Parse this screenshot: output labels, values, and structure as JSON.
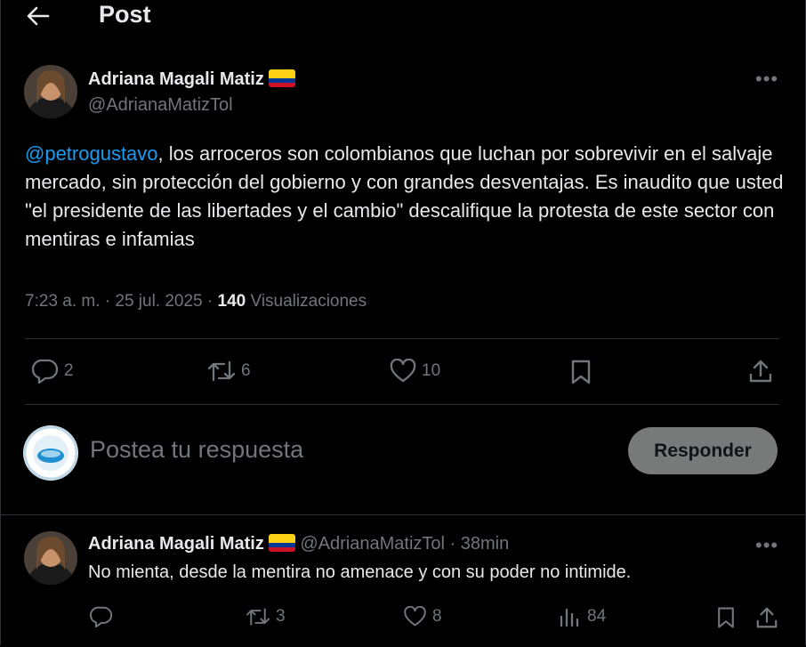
{
  "header": {
    "title": "Post",
    "back_icon": "arrow-left-icon"
  },
  "post": {
    "author_name": "Adriana Magali Matiz",
    "author_handle": "@AdrianaMatizTol",
    "flag": "colombia-flag",
    "mention": "@petrogustavo",
    "text": ", los arroceros son colombianos que luchan por sobrevivir en el salvaje mercado, sin protección del gobierno y con grandes desventajas. Es inaudito que usted \"el presidente de las libertades y el cambio\" descalifique la protesta de este sector con mentiras e infamias",
    "time": "7:23 a. m. · 25 jul. 2025 · ",
    "views_count": "140",
    "views_label": " Visualizaciones",
    "replies": "2",
    "reposts": "6",
    "likes": "10"
  },
  "composer": {
    "placeholder": "Postea tu respuesta",
    "button_label": "Responder"
  },
  "reply": {
    "author_name": "Adriana Magali Matiz",
    "author_handle": "@AdrianaMatizTol",
    "time": " · 38min",
    "text": "No mienta, desde la mentira no amenace y con su poder no intimide.",
    "reposts": "3",
    "likes": "8",
    "views": "84"
  },
  "colors": {
    "accent": "#1d9bf0",
    "muted": "#71767b",
    "text": "#e7e9ea",
    "border": "#2f3336",
    "button": "#787a7a"
  }
}
